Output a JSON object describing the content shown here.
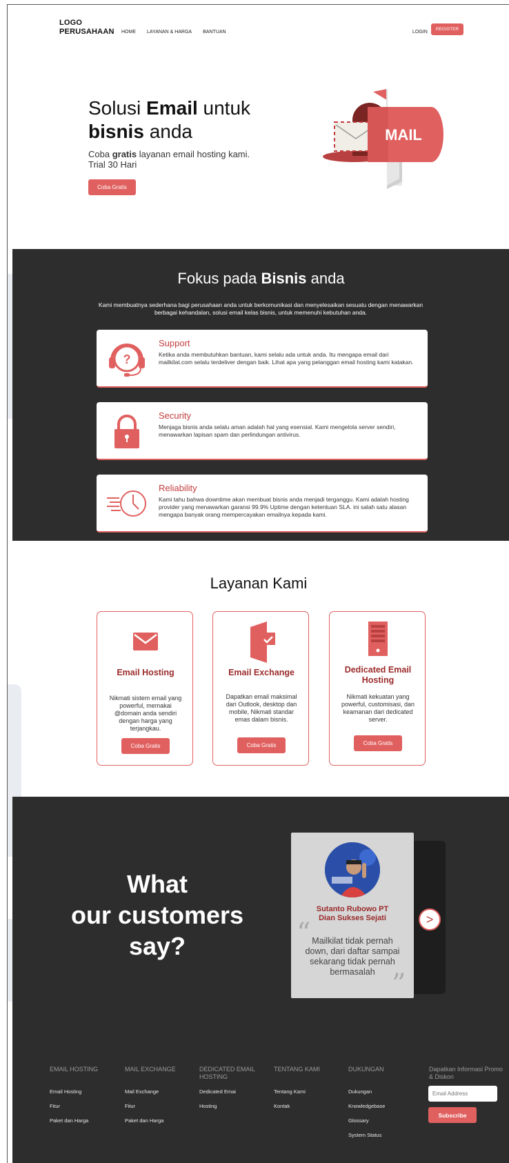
{
  "nav": {
    "logo_line1": "LOGO",
    "logo_line2": "PERUSAHAAN",
    "links": [
      "HOME",
      "LAYANAN & HARGA",
      "BANTUAN"
    ],
    "login": "LOGIN",
    "register": "REGISTER"
  },
  "hero": {
    "title_1": "Solusi ",
    "title_bold_1": "Email",
    "title_2": " untuk",
    "title_bold_2": "bisnis",
    "title_3": " anda",
    "sub_1": "Coba ",
    "sub_bold": "gratis",
    "sub_2": " layanan email hosting kami.",
    "sub_3": "Trial 30 Hari",
    "button": "Coba Gratis",
    "mailbox_label": "MAIL"
  },
  "fokus": {
    "title_1": "Fokus pada ",
    "title_bold": "Bisnis",
    "title_2": " anda",
    "description": "Kami membuatnya sederhana bagi perusahaan anda untuk berkomunikasi dan menyelesaikan sesuatu dengan menawarkan berbagai kehandalan, solusi email kelas bisnis, untuk memenuhi kebutuhan anda.",
    "cards": [
      {
        "title": "Support",
        "icon": "headset-icon",
        "text": "Ketika anda membutuhkan bantuan, kami selalu ada untuk anda. Itu mengapa email dari mailkilat.com selalu terdeliver dengan baik. Lihat apa yang pelanggan email hosting kami katakan."
      },
      {
        "title": "Security",
        "icon": "lock-icon",
        "text": "Menjaga bisnis anda selalu aman adalah hal yang esensial. Kami mengelola server sendiri, menawarkan lapisan spam dan perlindungan antivirus."
      },
      {
        "title": "Reliability",
        "icon": "fast-clock-icon",
        "text": "Kami tahu bahwa downtime akan membuat bisnis anda menjadi terganggu. Kami adalah hosting provider yang menawarkan garansi 99.9% Uptime dengan ketentuan SLA. ini salah satu alasan mengapa banyak orang mempercayakan emailnya kepada kami."
      }
    ]
  },
  "layanan": {
    "title": "Layanan Kami",
    "cards": [
      {
        "title": "Email Hosting",
        "icon": "envelope-icon",
        "text": "Nikmati sistem email yang powerful, memakai @domain anda sendiri dengan harga yang terjangkau.",
        "button": "Coba Gratis"
      },
      {
        "title": "Email Exchange",
        "icon": "exchange-icon",
        "text": "Dapatkan email maksimal dari Outlook, desktop dan mobile, Nikmati standar emas dalam bisnis.",
        "button": "Coba Gratis"
      },
      {
        "title": "Dedicated Email Hosting",
        "icon": "server-icon",
        "text": "Nikmati kekuatan yang powerful, customisasi, dan keamanan dari dedicated server.",
        "button": "Coba Gratis"
      }
    ]
  },
  "testimonial": {
    "heading_1": "What",
    "heading_2": "our customers",
    "heading_3": "say?",
    "name_1": "Sutanto Rubowo  PT",
    "name_2": "Dian Sukses Sejati",
    "quote": "Mailkilat tidak pernah down, dari daftar sampai sekarang tidak pernah bermasalah",
    "next": ">"
  },
  "footer": {
    "columns": [
      {
        "head": "EMAIL HOSTING",
        "items": [
          "Email Hosting",
          "Fitur",
          "Paket dan Harga"
        ]
      },
      {
        "head": "MAIL EXCHANGE",
        "items": [
          "Mail Exchange",
          "Fitur",
          "Paket dan Harga"
        ]
      },
      {
        "head": "DEDICATED EMAIL HOSTING",
        "items": [
          "Dedicated Emai",
          "Hosting"
        ]
      },
      {
        "head": "TENTANG KAMI",
        "items": [
          "Tentang Kami",
          "Kontak"
        ]
      },
      {
        "head": "DUKUNGAN",
        "items": [
          "Dukungan",
          "Knowledgebase",
          "Glossary",
          "System Status"
        ]
      }
    ],
    "promo": "Dapatkan Informasi Promo & Diskon",
    "email_placeholder": "Email Address",
    "subscribe": "Subscribe"
  },
  "colors": {
    "accent": "#e0605f",
    "accent_dark": "#9b2b2b",
    "dark_bg": "#2d2d2d"
  }
}
